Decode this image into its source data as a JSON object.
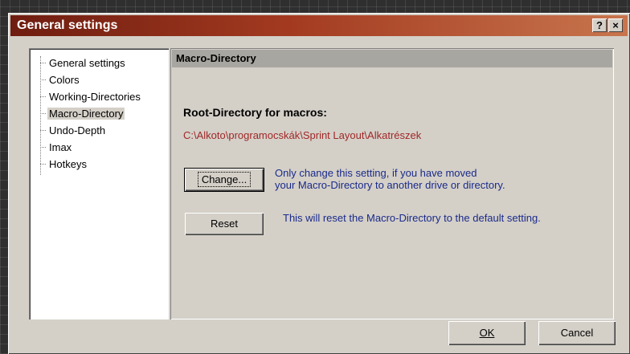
{
  "window": {
    "title": "General settings",
    "help_label": "?",
    "close_label": "×"
  },
  "sidebar": {
    "items": [
      {
        "label": "General settings",
        "selected": false
      },
      {
        "label": "Colors",
        "selected": false
      },
      {
        "label": "Working-Directories",
        "selected": false
      },
      {
        "label": "Macro-Directory",
        "selected": true
      },
      {
        "label": "Undo-Depth",
        "selected": false
      },
      {
        "label": "Imax",
        "selected": false
      },
      {
        "label": "Hotkeys",
        "selected": false
      }
    ]
  },
  "panel": {
    "title": "Macro-Directory",
    "section_label": "Root-Directory for macros:",
    "path": "C:\\Alkoto\\programocskák\\Sprint Layout\\Alkatrészek",
    "change_button": "Change...",
    "change_desc_line1": "Only change this setting, if you have moved",
    "change_desc_line2": "your Macro-Directory to another drive or directory.",
    "reset_button": "Reset",
    "reset_desc": "This will reset the Macro-Directory to the default setting."
  },
  "footer": {
    "ok_label": "OK",
    "cancel_label": "Cancel"
  },
  "colors": {
    "title_start": "#6e1d10",
    "title_end": "#c8754d",
    "path_text": "#a02828",
    "desc_text": "#1a2a8a",
    "dialog_face": "#d4d0c8"
  }
}
